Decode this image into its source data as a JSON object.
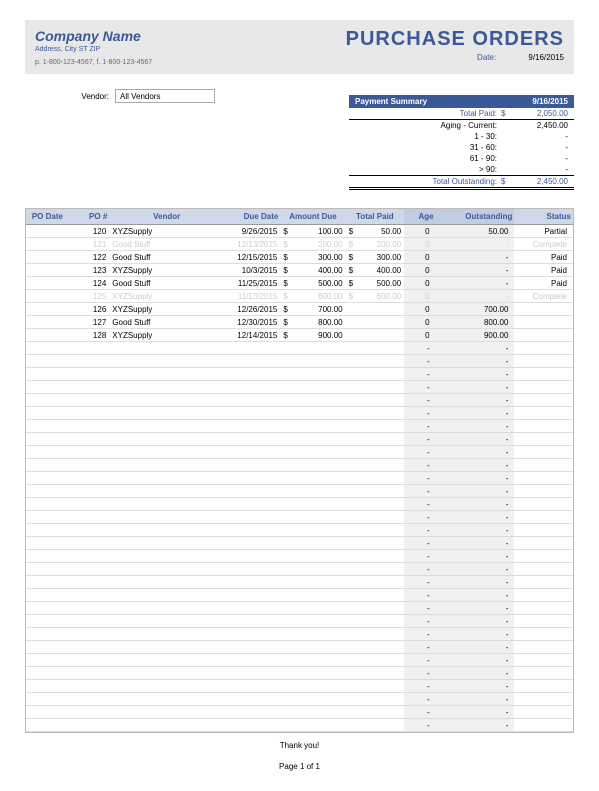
{
  "header": {
    "company_name": "Company Name",
    "address": "Address, City ST ZIP",
    "phone": "p. 1-800-123-4567, f. 1-800-123-4567",
    "title": "PURCHASE ORDERS",
    "date_label": "Date:",
    "date_value": "9/16/2015"
  },
  "vendor": {
    "label": "Vendor:",
    "value": "All Vendors"
  },
  "summary": {
    "title": "Payment Summary",
    "date": "9/16/2015",
    "rows": [
      {
        "label": "Total Paid:",
        "cur": "$",
        "value": "2,050.00",
        "cls": "total-paid"
      },
      {
        "label": "Aging - Current:",
        "cur": "",
        "value": "2,450.00",
        "cls": ""
      },
      {
        "label": "1 - 30:",
        "cur": "",
        "value": "-",
        "cls": ""
      },
      {
        "label": "31 - 60:",
        "cur": "",
        "value": "-",
        "cls": ""
      },
      {
        "label": "61 - 90:",
        "cur": "",
        "value": "-",
        "cls": ""
      },
      {
        "label": "> 90:",
        "cur": "",
        "value": "-",
        "cls": ""
      },
      {
        "label": "Total Outstanding:",
        "cur": "$",
        "value": "2,450.00",
        "cls": "outstanding"
      }
    ]
  },
  "table": {
    "headers": [
      "PO Date",
      "PO #",
      "Vendor",
      "Due Date",
      "Amount Due",
      "Total Paid",
      "Age",
      "Outstanding",
      "Status"
    ],
    "rows": [
      {
        "po_date": "",
        "po": "120",
        "vendor": "XYZSupply",
        "due": "9/26/2015",
        "amt": "100.00",
        "paid": "50.00",
        "age": "0",
        "out": "50.00",
        "status": "Partial",
        "faded": false
      },
      {
        "po_date": "",
        "po": "121",
        "vendor": "Good Stuff",
        "due": "12/13/2015",
        "amt": "200.00",
        "paid": "200.00",
        "age": "0",
        "out": "-",
        "status": "Complete",
        "faded": true
      },
      {
        "po_date": "",
        "po": "122",
        "vendor": "Good Stuff",
        "due": "12/15/2015",
        "amt": "300.00",
        "paid": "300.00",
        "age": "0",
        "out": "-",
        "status": "Paid",
        "faded": false
      },
      {
        "po_date": "",
        "po": "123",
        "vendor": "XYZSupply",
        "due": "10/3/2015",
        "amt": "400.00",
        "paid": "400.00",
        "age": "0",
        "out": "-",
        "status": "Paid",
        "faded": false
      },
      {
        "po_date": "",
        "po": "124",
        "vendor": "Good Stuff",
        "due": "11/25/2015",
        "amt": "500.00",
        "paid": "500.00",
        "age": "0",
        "out": "-",
        "status": "Paid",
        "faded": false
      },
      {
        "po_date": "",
        "po": "125",
        "vendor": "XYZSupply",
        "due": "11/13/2015",
        "amt": "600.00",
        "paid": "600.00",
        "age": "0",
        "out": "-",
        "status": "Complete",
        "faded": true
      },
      {
        "po_date": "",
        "po": "126",
        "vendor": "XYZSupply",
        "due": "12/26/2015",
        "amt": "700.00",
        "paid": "",
        "age": "0",
        "out": "700.00",
        "status": "",
        "faded": false
      },
      {
        "po_date": "",
        "po": "127",
        "vendor": "Good Stuff",
        "due": "12/30/2015",
        "amt": "800.00",
        "paid": "",
        "age": "0",
        "out": "800.00",
        "status": "",
        "faded": false
      },
      {
        "po_date": "",
        "po": "128",
        "vendor": "XYZSupply",
        "due": "12/14/2015",
        "amt": "900.00",
        "paid": "",
        "age": "0",
        "out": "900.00",
        "status": "",
        "faded": false
      }
    ],
    "empty_rows": 30
  },
  "footer": {
    "thanks": "Thank you!",
    "pager": "Page 1 of 1"
  }
}
